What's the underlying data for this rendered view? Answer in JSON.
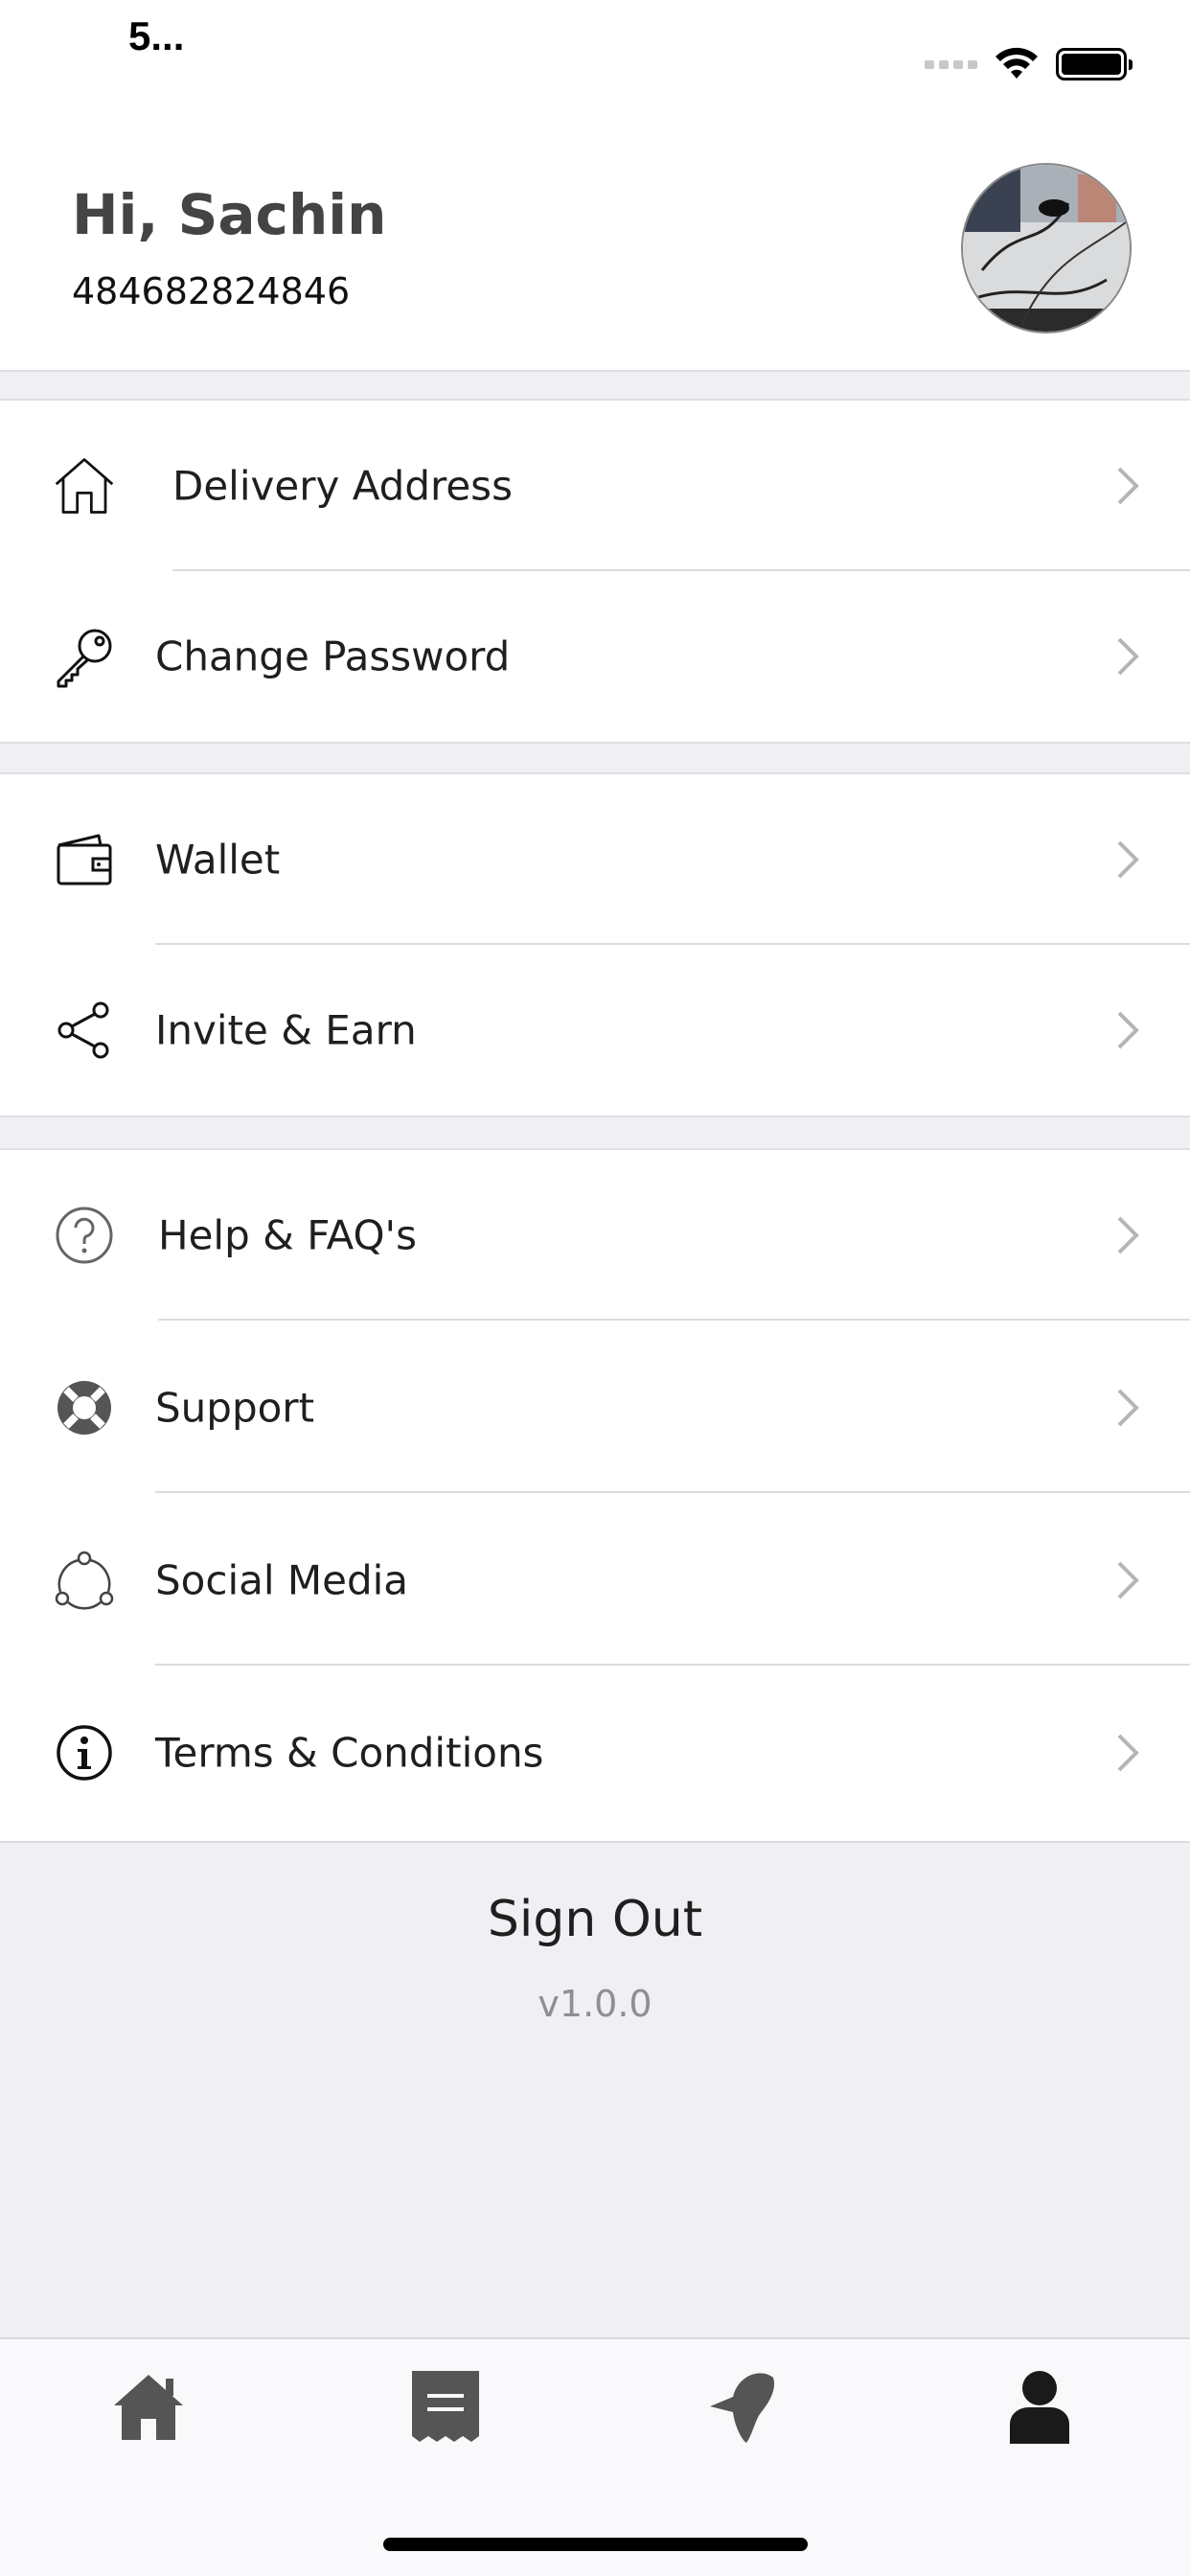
{
  "status_bar": {
    "time": "5..."
  },
  "header": {
    "greeting": "Hi, Sachin",
    "phone": "484682824846"
  },
  "menu": {
    "delivery_address": "Delivery Address",
    "change_password": "Change Password",
    "wallet": "Wallet",
    "invite_earn": "Invite & Earn",
    "help_faq": "Help & FAQ's",
    "support": "Support",
    "social_media": "Social Media",
    "terms": "Terms & Conditions"
  },
  "footer": {
    "sign_out": "Sign Out",
    "version": "v1.0.0"
  },
  "tabbar": {
    "tabs": [
      "home-icon",
      "receipt-icon",
      "notification-icon",
      "profile-icon"
    ],
    "active_tab": "profile-icon"
  },
  "colors": {
    "active_tab": "#1a1a1a",
    "inactive_tab": "#555555",
    "band": "#efeff4"
  }
}
